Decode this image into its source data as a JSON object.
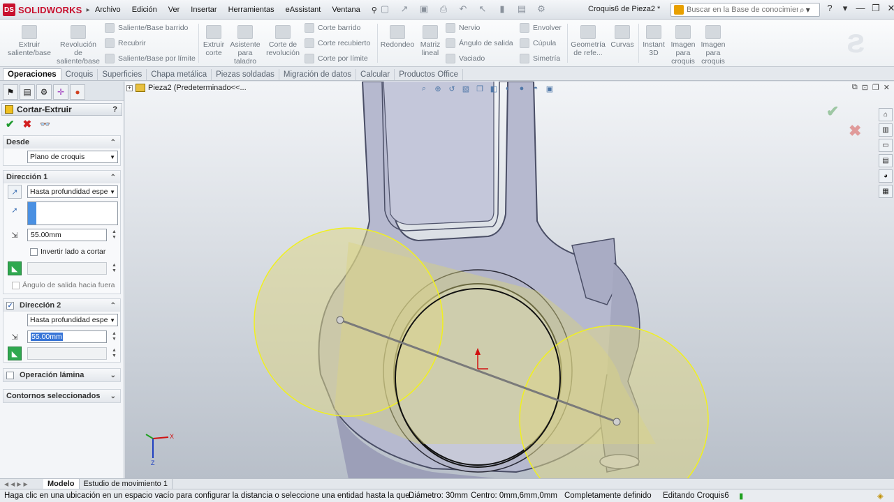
{
  "app": {
    "brand": "SOLIDWORKS",
    "document_title": "Croquis6 de Pieza2 *"
  },
  "menu": [
    "Archivo",
    "Edición",
    "Ver",
    "Insertar",
    "Herramientas",
    "eAssistant",
    "Ventana"
  ],
  "search": {
    "placeholder": "Buscar en la Base de conocimiento"
  },
  "ribbon": {
    "big_buttons": [
      {
        "label": "Extruir saliente/base"
      },
      {
        "label": "Revolución de saliente/base"
      },
      {
        "label": "Extruir corte"
      },
      {
        "label": "Asistente para taladro"
      },
      {
        "label": "Corte de revolución"
      },
      {
        "label": "Redondeo"
      },
      {
        "label": "Matriz lineal"
      },
      {
        "label": "Geometría de refe..."
      },
      {
        "label": "Curvas"
      },
      {
        "label": "Instant 3D"
      },
      {
        "label": "Imagen para croquis"
      },
      {
        "label": "Imagen para croquis"
      }
    ],
    "small_buttons": [
      {
        "label": "Saliente/Base barrido"
      },
      {
        "label": "Recubrir"
      },
      {
        "label": "Saliente/Base por límite"
      },
      {
        "label": "Corte barrido"
      },
      {
        "label": "Corte recubierto"
      },
      {
        "label": "Corte por límite"
      },
      {
        "label": "Nervio"
      },
      {
        "label": "Ángulo de salida"
      },
      {
        "label": "Vaciado"
      },
      {
        "label": "Envolver"
      },
      {
        "label": "Cúpula"
      },
      {
        "label": "Simetría"
      }
    ]
  },
  "tabs": [
    {
      "label": "Operaciones",
      "active": true
    },
    {
      "label": "Croquis"
    },
    {
      "label": "Superficies"
    },
    {
      "label": "Chapa metálica"
    },
    {
      "label": "Piezas soldadas"
    },
    {
      "label": "Migración de datos"
    },
    {
      "label": "Calcular"
    },
    {
      "label": "Productos Office"
    }
  ],
  "property_manager": {
    "title": "Cortar-Extruir",
    "help": "?",
    "from": {
      "label": "Desde",
      "value": "Plano de croquis"
    },
    "direction1": {
      "label": "Dirección 1",
      "end_condition": "Hasta profundidad espe",
      "depth": "55.00mm",
      "flip_side_label": "Invertir lado a cortar",
      "draft_label": "Ángulo de salida hacia fuera"
    },
    "direction2": {
      "label": "Dirección 2",
      "checked": true,
      "end_condition": "Hasta profundidad espe",
      "depth": "55.00mm"
    },
    "thin_feature": {
      "label": "Operación lámina"
    },
    "selected_contours": {
      "label": "Contornos seleccionados"
    }
  },
  "viewport": {
    "breadcrumb": "Pieza2  (Predeterminado<<..."
  },
  "bottom_tabs": [
    {
      "label": "Modelo",
      "active": true
    },
    {
      "label": "Estudio de movimiento 1"
    }
  ],
  "status": {
    "message": "Haga clic en una ubicación en un espacio vacío para configurar la distancia o seleccione una entidad hasta la que ...",
    "diameter": "Diámetro: 30mm",
    "center": "Centro: 0mm,6mm,0mm",
    "definition": "Completamente definido",
    "editing": "Editando Croquis6"
  },
  "colors": {
    "sketch_fill": "#d8d27a",
    "sketch_edge": "#f0f020",
    "part_body": "#b6b9cf",
    "ok_green": "#1f9a2e",
    "cancel_red": "#d21f1f"
  }
}
